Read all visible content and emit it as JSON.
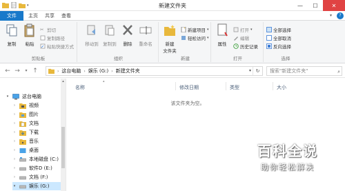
{
  "window": {
    "title": "新建文件夹",
    "minimize": "—",
    "maximize": "☐",
    "close": "✕"
  },
  "ribbon_tabs": [
    "文件",
    "主页",
    "共享",
    "查看"
  ],
  "ribbon": {
    "clipboard": {
      "label": "剪贴板",
      "copy": "复制",
      "paste": "粘贴",
      "cut": "剪切",
      "copy_path": "复制路径",
      "paste_shortcut": "粘贴快捷方式"
    },
    "organize": {
      "label": "组织",
      "move_to": "移动到",
      "copy_to": "复制到",
      "delete": "删除",
      "rename": "重命名"
    },
    "new": {
      "label": "新建",
      "new_folder": "新建\n文件夹",
      "new_item": "新建项目",
      "easy_access": "轻松访问"
    },
    "open": {
      "label": "打开",
      "properties": "属性",
      "open": "打开",
      "edit": "编辑",
      "history": "历史记录"
    },
    "select": {
      "label": "选择",
      "select_all": "全部选择",
      "select_none": "全部取消",
      "invert": "反向选择"
    }
  },
  "address": {
    "crumbs": [
      "这台电脑",
      "娱乐 (G:)",
      "新建文件夹"
    ],
    "search_placeholder": "搜索\"新建文件夹\""
  },
  "nav": {
    "items": [
      {
        "label": "这台电脑",
        "icon": "computer-icon"
      },
      {
        "label": "视频",
        "icon": "videos-folder-icon"
      },
      {
        "label": "图片",
        "icon": "pictures-folder-icon"
      },
      {
        "label": "文档",
        "icon": "documents-folder-icon"
      },
      {
        "label": "下载",
        "icon": "downloads-folder-icon"
      },
      {
        "label": "音乐",
        "icon": "music-folder-icon"
      },
      {
        "label": "桌面",
        "icon": "desktop-folder-icon"
      },
      {
        "label": "本地磁盘 (C:)",
        "icon": "drive-icon"
      },
      {
        "label": "软件D (E:)",
        "icon": "drive-icon"
      },
      {
        "label": "文档 (F:)",
        "icon": "drive-icon"
      },
      {
        "label": "娱乐 (G:)",
        "icon": "drive-icon"
      }
    ]
  },
  "content": {
    "columns": [
      "名称",
      "修改日期",
      "类型",
      "大小"
    ],
    "empty_message": "该文件夹为空。"
  },
  "watermark": {
    "title": "百科全说",
    "subtitle": "助你轻松解决"
  },
  "colors": {
    "accent": "#1979ca",
    "close": "#e04343",
    "folder": "#e8b83c"
  }
}
